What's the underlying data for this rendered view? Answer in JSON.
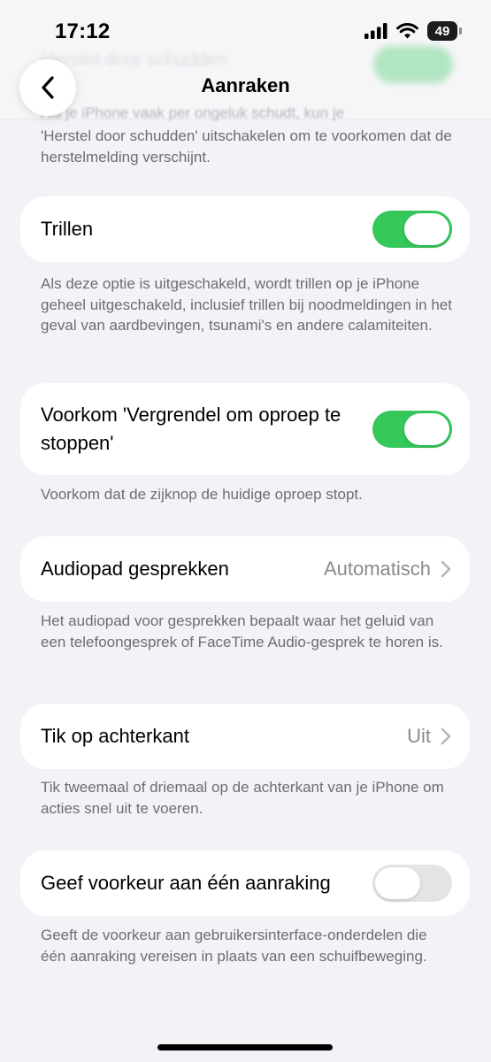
{
  "status_bar": {
    "time": "17:12",
    "battery_level": "49",
    "icons": [
      "cellular-signal-icon",
      "wifi-icon",
      "battery-icon"
    ]
  },
  "nav": {
    "title": "Aanraken",
    "back_icon": "chevron-left-icon",
    "scrolled_row_label": "Herstel door schudden",
    "scrolled_text": "Als je iPhone vaak per ongeluk schudt, kun je"
  },
  "top_footer": "'Herstel door schudden' uitschakelen om te voorkomen dat de herstelmelding verschijnt.",
  "settings": {
    "trillen": {
      "label": "Trillen",
      "toggle_on": true,
      "footer": "Als deze optie is uitgeschakeld, wordt trillen op je iPhone geheel uitgeschakeld, inclusief trillen bij noodmeldingen in het geval van aardbevingen, tsunami's en andere calamiteiten."
    },
    "voorkom_vergrendel": {
      "label": "Voorkom 'Vergrendel om oproep te stoppen'",
      "toggle_on": true,
      "footer": "Voorkom dat de zijknop de huidige oproep stopt."
    },
    "audiopad": {
      "label": "Audiopad gesprekken",
      "value": "Automatisch",
      "footer": "Het audiopad voor gesprekken bepaalt waar het geluid van een telefoongesprek of FaceTime Audio-gesprek te horen is."
    },
    "tik_achterkant": {
      "label": "Tik op achterkant",
      "value": "Uit",
      "footer": "Tik tweemaal of driemaal op de achterkant van je iPhone om acties snel uit te voeren."
    },
    "een_aanraking": {
      "label": "Geef voorkeur aan één aanraking",
      "toggle_on": false,
      "footer": "Geeft de voorkeur aan gebruikersinterface-onderdelen die één aanraking vereisen in plaats van een schuifbeweging."
    }
  },
  "colors": {
    "toggle_on": "#34c759",
    "toggle_off": "#e4e4e7",
    "background": "#f2f2f7",
    "secondary_text": "#6d6d72"
  }
}
